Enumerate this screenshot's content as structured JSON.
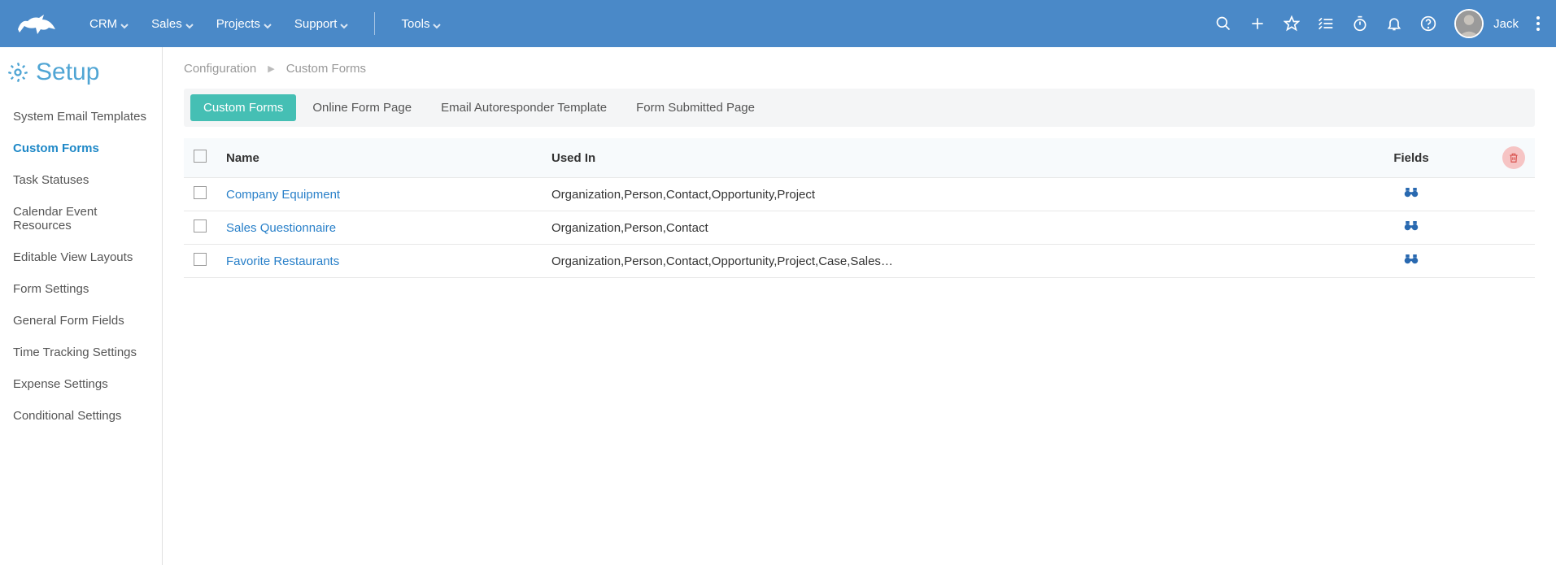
{
  "top_nav": {
    "items": [
      {
        "label": "CRM",
        "dropdown": true
      },
      {
        "label": "Sales",
        "dropdown": true
      },
      {
        "label": "Projects",
        "dropdown": true
      },
      {
        "label": "Support",
        "dropdown": true
      },
      {
        "label": "Tools",
        "dropdown": true
      }
    ]
  },
  "user": {
    "name": "Jack"
  },
  "sidebar": {
    "title": "Setup",
    "items": [
      {
        "label": "System Email Templates",
        "active": false
      },
      {
        "label": "Custom Forms",
        "active": true
      },
      {
        "label": "Task Statuses",
        "active": false
      },
      {
        "label": "Calendar Event Resources",
        "active": false
      },
      {
        "label": "Editable View Layouts",
        "active": false
      },
      {
        "label": "Form Settings",
        "active": false
      },
      {
        "label": "General Form Fields",
        "active": false
      },
      {
        "label": "Time Tracking Settings",
        "active": false
      },
      {
        "label": "Expense Settings",
        "active": false
      },
      {
        "label": "Conditional Settings",
        "active": false
      }
    ]
  },
  "breadcrumb": {
    "parent": "Configuration",
    "current": "Custom Forms"
  },
  "tabs": [
    {
      "label": "Custom Forms",
      "active": true
    },
    {
      "label": "Online Form Page",
      "active": false
    },
    {
      "label": "Email Autoresponder Template",
      "active": false
    },
    {
      "label": "Form Submitted Page",
      "active": false
    }
  ],
  "table": {
    "headers": {
      "name": "Name",
      "used_in": "Used In",
      "fields": "Fields"
    },
    "rows": [
      {
        "name": "Company Equipment",
        "used_in": "Organization,Person,Contact,Opportunity,Project"
      },
      {
        "name": "Sales Questionnaire",
        "used_in": "Organization,Person,Contact"
      },
      {
        "name": "Favorite Restaurants",
        "used_in": "Organization,Person,Contact,Opportunity,Project,Case,Sales…"
      }
    ]
  }
}
